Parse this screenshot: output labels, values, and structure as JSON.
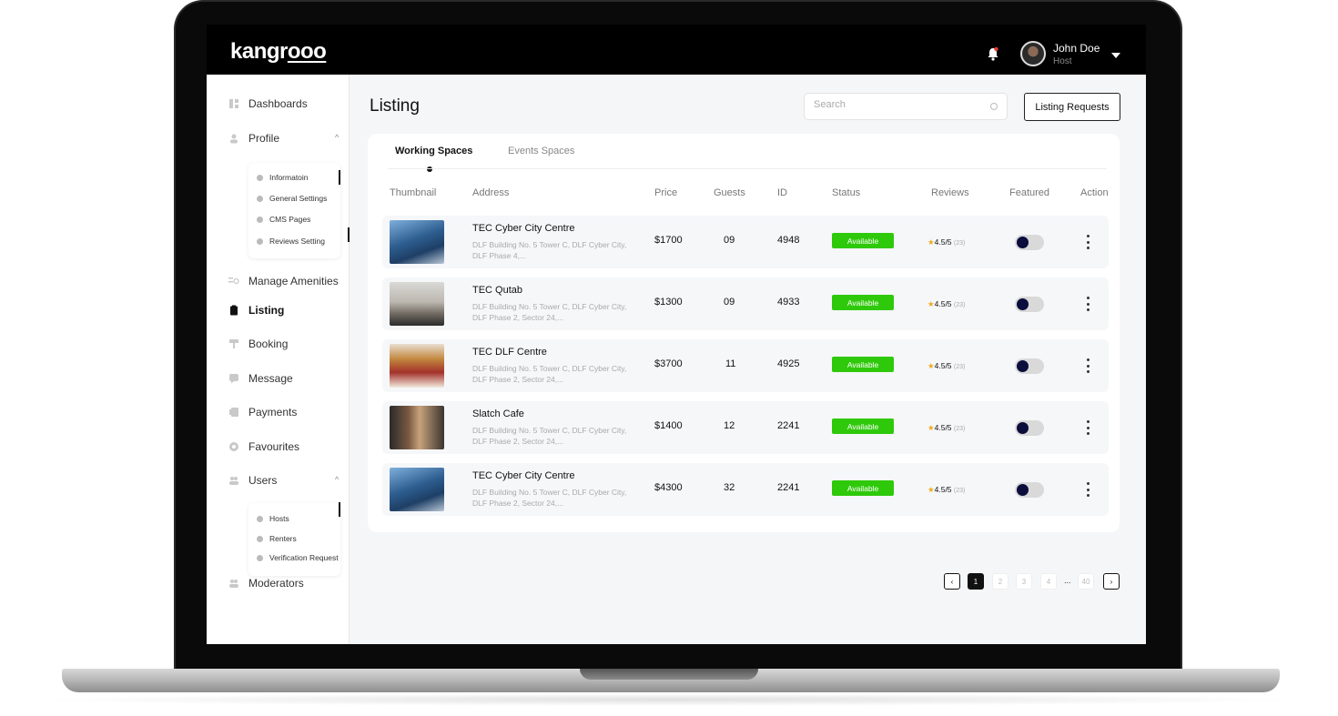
{
  "header": {
    "logo_prefix": "kangr",
    "logo_suffix": "ooo",
    "user_name": "John Doe",
    "user_role": "Host"
  },
  "sidebar": {
    "items": [
      {
        "label": "Dashboards",
        "icon": "grid-icon"
      },
      {
        "label": "Profile",
        "icon": "person-icon"
      },
      {
        "label": "Manage Amenities",
        "icon": "amenities-icon"
      },
      {
        "label": "Listing",
        "icon": "clipboard-icon"
      },
      {
        "label": "Booking",
        "icon": "booking-icon"
      },
      {
        "label": "Message",
        "icon": "chat-icon"
      },
      {
        "label": "Payments",
        "icon": "payments-icon"
      },
      {
        "label": "Favourites",
        "icon": "heart-icon"
      },
      {
        "label": "Users",
        "icon": "users-icon"
      },
      {
        "label": "Moderators",
        "icon": "users-icon"
      }
    ],
    "profile_sub": [
      {
        "label": "Informatoin",
        "icon": "info-icon"
      },
      {
        "label": "General Settings",
        "icon": "gear-icon"
      },
      {
        "label": "CMS Pages",
        "icon": "pages-icon"
      },
      {
        "label": "Reviews Setting",
        "icon": "star-icon"
      }
    ],
    "users_sub": [
      {
        "label": "Hosts",
        "icon": "host-icon"
      },
      {
        "label": "Renters",
        "icon": "flag-icon"
      },
      {
        "label": "Verification Request",
        "icon": "verify-icon"
      }
    ]
  },
  "main": {
    "title": "Listing",
    "search_placeholder": "Search",
    "requests_button": "Listing Requests",
    "tabs": [
      "Working Spaces",
      "Events Spaces"
    ],
    "active_tab": "Working Spaces",
    "columns": [
      "Thumbnail",
      "Address",
      "Price",
      "Guests",
      "ID",
      "Status",
      "Reviews",
      "Featured",
      "Action"
    ],
    "rows": [
      {
        "name": "TEC Cyber City Centre",
        "address": "DLF Building No. 5 Tower C, DLF Cyber City, DLF Phase 4,...",
        "price": "$1700",
        "guests": "09",
        "id": "4948",
        "status": "Available",
        "rating": "4.5/5",
        "reviews": "(23)",
        "thumb": "t1"
      },
      {
        "name": "TEC Qutab",
        "address": "DLF Building No. 5 Tower C, DLF Cyber City, DLF Phase 2, Sector 24,...",
        "price": "$1300",
        "guests": "09",
        "id": "4933",
        "status": "Available",
        "rating": "4.5/5",
        "reviews": "(23)",
        "thumb": "t2"
      },
      {
        "name": "TEC DLF Centre",
        "address": "DLF Building No. 5 Tower C, DLF Cyber City, DLF Phase 2, Sector 24,...",
        "price": "$3700",
        "guests": "11",
        "id": "4925",
        "status": "Available",
        "rating": "4.5/5",
        "reviews": "(23)",
        "thumb": "t3"
      },
      {
        "name": "Slatch Cafe",
        "address": "DLF Building No. 5 Tower C, DLF Cyber City, DLF Phase 2, Sector 24,...",
        "price": "$1400",
        "guests": "12",
        "id": "2241",
        "status": "Available",
        "rating": "4.5/5",
        "reviews": "(23)",
        "thumb": "t4"
      },
      {
        "name": "TEC Cyber City Centre",
        "address": "DLF Building No. 5 Tower C, DLF Cyber City, DLF Phase 2, Sector 24,...",
        "price": "$4300",
        "guests": "32",
        "id": "2241",
        "status": "Available",
        "rating": "4.5/5",
        "reviews": "(23)",
        "thumb": "t1"
      }
    ],
    "pagination": {
      "prev": "‹",
      "pages": [
        "1",
        "2",
        "3",
        "4"
      ],
      "ellipsis": "...",
      "last": "40",
      "next": "›",
      "current": "1"
    }
  },
  "colors": {
    "status_available": "#2fc90b",
    "toggle_knob": "#0b0d3d",
    "star": "#f1a81a",
    "topbar": "#000000"
  }
}
